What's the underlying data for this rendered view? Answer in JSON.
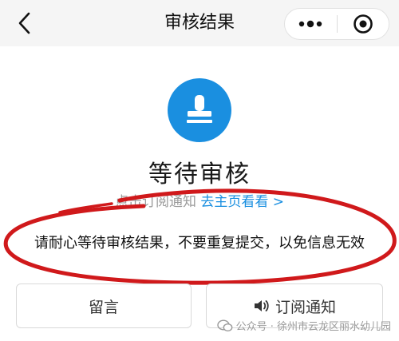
{
  "nav": {
    "title": "审核结果",
    "more_icon": "more-dots-icon",
    "close_icon": "target-close-icon"
  },
  "status": {
    "icon": "stamp-icon",
    "icon_color": "#1a8fe0",
    "title": "等待审核"
  },
  "subscribe_hint": {
    "text": "点击订阅通知",
    "link": "去主页看看 >"
  },
  "notice": {
    "text": "请耐心等待审核结果，不要重复提交，以免信息无效"
  },
  "buttons": {
    "message_label": "留言",
    "subscribe_label": "订阅通知",
    "subscribe_icon": "speaker-icon"
  },
  "watermark": {
    "text": "公众号 · 徐州市云龙区丽水幼儿园"
  },
  "colors": {
    "accent": "#1a8fe0",
    "annotation_red": "#d0191b"
  }
}
